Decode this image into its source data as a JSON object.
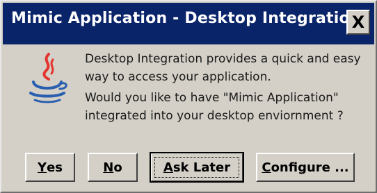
{
  "window": {
    "title": "Mimic Application - Desktop Integration",
    "close_label": "X",
    "background": "#d4d0c8",
    "titlebar_color": "#0a246a"
  },
  "icon": {
    "name": "java-coffee-cup-icon",
    "steam_color": "#e3342f",
    "cup_color": "#2a5fb0"
  },
  "message": {
    "line1": "Desktop Integration provides a quick and easy",
    "line2": "way to access your application.",
    "line3": "Would you like to have  \"Mimic Application\"",
    "line4": "integrated into your desktop enviornment ?"
  },
  "buttons": {
    "yes": {
      "mnemonic": "Y",
      "rest": "es"
    },
    "no": {
      "mnemonic": "N",
      "rest": "o"
    },
    "ask_later": {
      "mnemonic": "A",
      "rest": "sk Later"
    },
    "configure": {
      "mnemonic": "C",
      "rest": "onfigure ..."
    }
  }
}
